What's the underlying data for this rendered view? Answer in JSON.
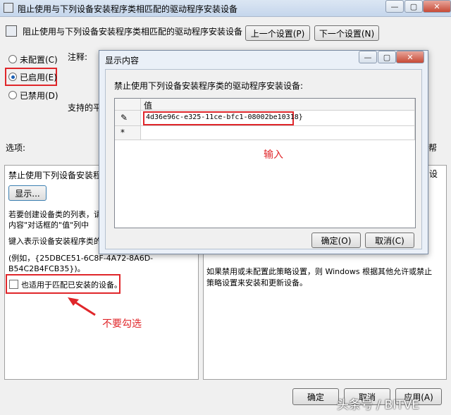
{
  "window": {
    "title": "阻止使用与下列设备安装程序类相匹配的驱动程序安装设备",
    "header_title": "阻止使用与下列设备安装程序类相匹配的驱动程序安装设备",
    "prev_setting": "上一个设置(P)",
    "next_setting": "下一个设置(N)",
    "radio_not_configured": "未配置(C)",
    "radio_enabled": "已启用(E)",
    "radio_disabled": "已禁用(D)",
    "comment_label": "注释:",
    "supported_label": "支持的平",
    "options_label": "选项:",
    "help_label": "帮",
    "ok": "确定",
    "cancel": "取消",
    "apply": "应用(A)"
  },
  "options": {
    "prohibit_label": "禁止使用下列设备安装程序",
    "show_button": "显示...",
    "desc_line1": "若要创建设备类的列表，请",
    "desc_line2": "内容\"对话框的\"值\"列中",
    "enter_line": "键入表示设备安装程序类的",
    "example_line1": "(例如，{25DBCE51-6C8F-4A72-8A6D-",
    "example_line2": "B54C2B4FCB35})。",
    "checkbox_label": "也适用于匹配已安装的设备。"
  },
  "help": {
    "line1": "如果禁用或未配置此策略设置，则 Windows 根据其他允许或禁止",
    "line2": "策略设置来安装和更新设备。",
    "right_edge_char": "设"
  },
  "dialog": {
    "title": "显示内容",
    "prompt": "禁止使用下列设备安装程序类的驱动程序安装设备:",
    "column_header": "值",
    "rows": [
      {
        "marker": "✎",
        "value": "4d36e96c-e325-11ce-bfc1-08002be10318}"
      },
      {
        "marker": "*",
        "value": ""
      }
    ],
    "ok": "确定(O)",
    "cancel": "取消(C)"
  },
  "annotations": {
    "input": "输入",
    "do_not_check": "不要勾选"
  },
  "watermark": "头条号 / BITVE",
  "colors": {
    "highlight": "#e0262a",
    "radio_dot": "#1a5fb4"
  }
}
